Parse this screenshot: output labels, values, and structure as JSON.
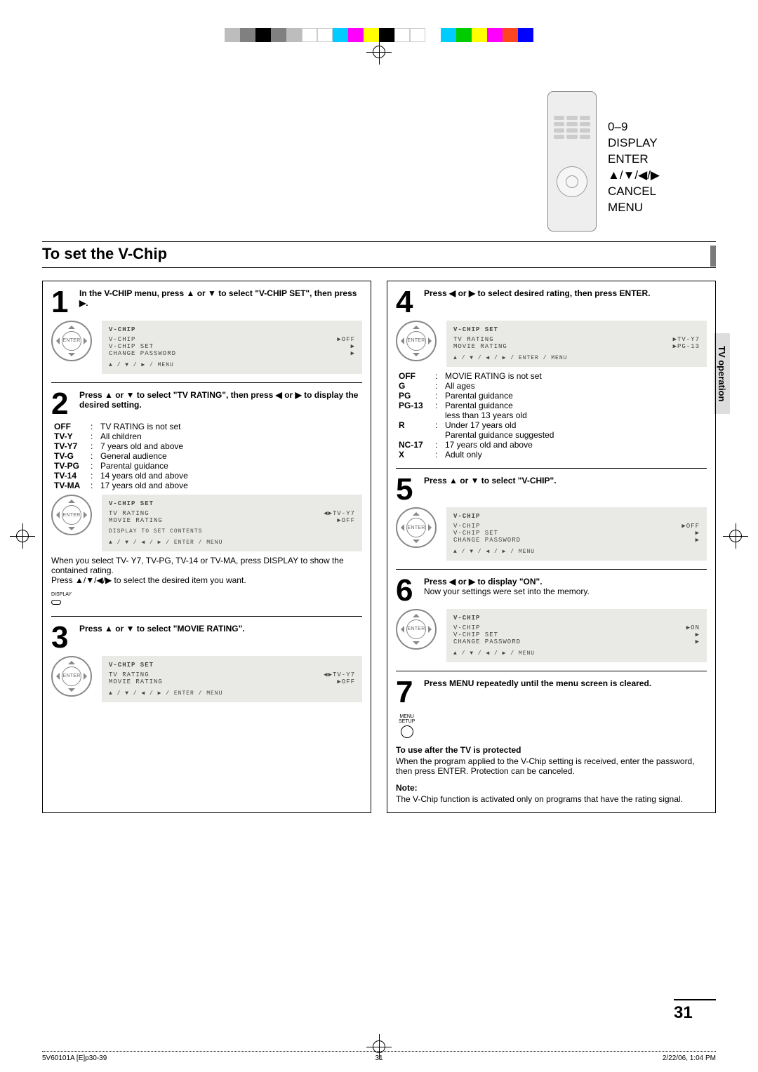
{
  "page_number": "31",
  "side_tab": "TV operation",
  "remote_labels": [
    "0–9",
    "DISPLAY",
    "ENTER",
    "▲/▼/◀/▶",
    "CANCEL",
    "MENU"
  ],
  "section_title": "To set the V-Chip",
  "steps": {
    "1": {
      "num": "1",
      "text_bold": "In the V-CHIP menu, press ▲ or ▼ to select \"V-CHIP SET\", then press ▶."
    },
    "2": {
      "num": "2",
      "text_bold": "Press ▲ or ▼ to select \"TV RATING\", then press ◀ or ▶ to display the desired setting."
    },
    "2_post": [
      "When you select TV- Y7, TV-PG, TV-14 or TV-MA, press DISPLAY to show the contained rating.",
      "Press ▲/▼/◀/▶  to select the desired item you want."
    ],
    "3": {
      "num": "3",
      "text_bold": "Press ▲ or ▼  to select \"MOVIE RATING\"."
    },
    "4": {
      "num": "4",
      "text_bold": "Press ◀ or ▶ to select desired rating, then press ENTER."
    },
    "5": {
      "num": "5",
      "text_bold": "Press ▲ or ▼  to select \"V-CHIP\"."
    },
    "6": {
      "num": "6",
      "text_bold": "Press ◀ or ▶ to display \"ON\".",
      "text_plain": "Now your settings were set into the memory."
    },
    "7": {
      "num": "7",
      "text_bold": "Press MENU repeatedly until the menu screen is cleared."
    }
  },
  "tv_ratings": [
    {
      "k": "OFF",
      "v": "TV RATING is not set"
    },
    {
      "k": "TV-Y",
      "v": "All children"
    },
    {
      "k": "TV-Y7",
      "v": "7 years old and above"
    },
    {
      "k": "TV-G",
      "v": "General audience"
    },
    {
      "k": "TV-PG",
      "v": "Parental guidance"
    },
    {
      "k": "TV-14",
      "v": "14 years old and above"
    },
    {
      "k": "TV-MA",
      "v": "17 years old and above"
    }
  ],
  "movie_ratings": [
    {
      "k": "OFF",
      "v": "MOVIE RATING is not set"
    },
    {
      "k": "G",
      "v": "All ages"
    },
    {
      "k": "PG",
      "v": "Parental guidance"
    },
    {
      "k": "PG-13",
      "v": "Parental guidance\nless than 13 years old"
    },
    {
      "k": "R",
      "v": "Under 17 years old\nParental guidance suggested"
    },
    {
      "k": "NC-17",
      "v": "17 years old and above"
    },
    {
      "k": "X",
      "v": "Adult only"
    }
  ],
  "osd": {
    "vchip_menu": {
      "hdr": "V-CHIP",
      "rows": [
        {
          "l": "V-CHIP",
          "r": "▶OFF"
        },
        {
          "l": "V-CHIP SET",
          "r": "▶"
        },
        {
          "l": "CHANGE PASSWORD",
          "r": "▶"
        }
      ],
      "help": "▲ / ▼ / ▶ / MENU"
    },
    "vchip_set_tv": {
      "hdr": "V-CHIP SET",
      "rows": [
        {
          "l": "TV RATING",
          "r": "◀▶TV-Y7"
        },
        {
          "l": "MOVIE RATING",
          "r": "▶OFF"
        }
      ],
      "help1": "DISPLAY TO SET CONTENTS",
      "help2": "▲ / ▼ / ◀ / ▶ / ENTER / MENU"
    },
    "vchip_set_movie": {
      "hdr": "V-CHIP SET",
      "rows": [
        {
          "l": "TV RATING",
          "r": "◀▶TV-Y7"
        },
        {
          "l": "MOVIE RATING",
          "r": "▶OFF"
        }
      ],
      "help": "▲ / ▼ / ◀ / ▶ / ENTER / MENU"
    },
    "vchip_set_both": {
      "hdr": "V-CHIP SET",
      "rows": [
        {
          "l": "TV RATING",
          "r": "▶TV-Y7"
        },
        {
          "l": "MOVIE RATING",
          "r": "▶PG-13"
        }
      ],
      "help": "▲ / ▼ / ◀ / ▶ / ENTER / MENU"
    },
    "vchip_menu_5": {
      "hdr": "V-CHIP",
      "rows": [
        {
          "l": "V-CHIP",
          "r": "▶OFF"
        },
        {
          "l": "V-CHIP SET",
          "r": "▶"
        },
        {
          "l": "CHANGE PASSWORD",
          "r": "▶"
        }
      ],
      "help": "▲ / ▼ / ◀ / ▶ / MENU"
    },
    "vchip_menu_on": {
      "hdr": "V-CHIP",
      "rows": [
        {
          "l": "V-CHIP",
          "r": "▶ON"
        },
        {
          "l": "V-CHIP SET",
          "r": "▶"
        },
        {
          "l": "CHANGE PASSWORD",
          "r": "▶"
        }
      ],
      "help": "▲ / ▼ / ◀ / ▶ / MENU"
    }
  },
  "display_label": "DISPLAY",
  "menu_setup_label": "MENU\nSETUP",
  "after": {
    "hdr": "To use after the TV is protected",
    "body": "When the program applied to the V-Chip setting is received, enter the password, then press ENTER. Protection can be canceled."
  },
  "note": {
    "hdr": "Note:",
    "body": "The V-Chip function is activated only on programs that have the rating signal."
  },
  "footer": {
    "left": "5V60101A [E]p30-39",
    "mid": "31",
    "right": "2/22/06, 1:04 PM"
  },
  "enter_label": "ENTER"
}
